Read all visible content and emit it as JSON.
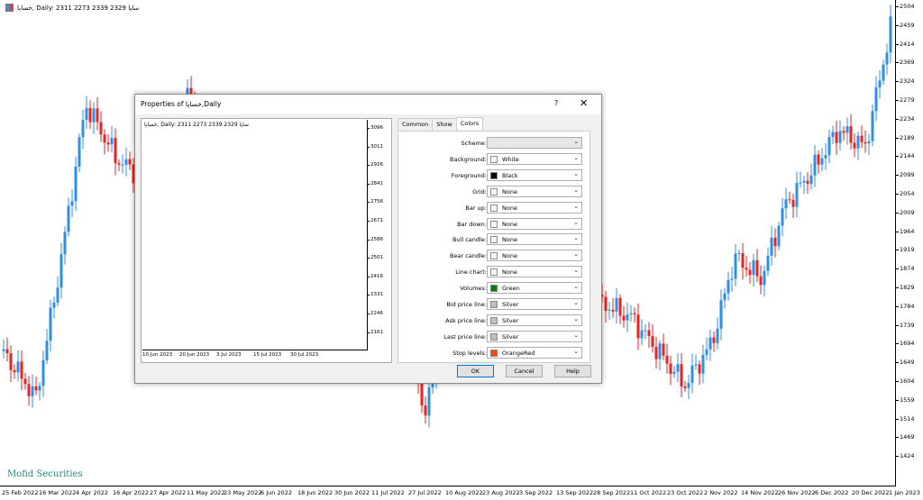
{
  "window": {
    "caption": "خساپا, Daily:  2311 2273 2339 2329  ساپا",
    "watermark": "Mofid Securities"
  },
  "price_scale": [
    "2504",
    "2459",
    "2414",
    "2369",
    "2324",
    "2279",
    "2234",
    "2189",
    "2144",
    "2099",
    "2054",
    "2009",
    "1964",
    "1919",
    "1874",
    "1829",
    "1784",
    "1739",
    "1694",
    "1649",
    "1604",
    "1559",
    "1514",
    "1469",
    "1424"
  ],
  "time_scale": [
    "25 Feb 2022",
    "16 Mar 2022",
    "4 Apr 2022",
    "16 Apr 2022",
    "27 Apr 2022",
    "11 May 2022",
    "23 May 2022",
    "6 Jun 2022",
    "18 Jun 2022",
    "30 Jun 2022",
    "11 Jul 2022",
    "27 Jul 2022",
    "10 Aug 2022",
    "23 Aug 2022",
    "3 Sep 2022",
    "13 Sep 2022",
    "28 Sep 2022",
    "11 Oct 2022",
    "23 Oct 2022",
    "2 Nov 2022",
    "14 Nov 2022",
    "26 Nov 2022",
    "6 Dec 2022",
    "20 Dec 2022",
    "1 Jan 2023"
  ],
  "colors": {
    "bull": "#2f8fe8",
    "bear": "#ee2222",
    "bg": "#ffffff"
  },
  "dialog": {
    "title": "Properties of خساپا,Daily",
    "help_icon": "?",
    "close_icon": "✕",
    "preview": {
      "caption": "خساپا, Daily:  2311 2273 2339 2329  ساپا",
      "prices": [
        "3096",
        "3011",
        "2926",
        "2841",
        "2756",
        "2671",
        "2586",
        "2501",
        "2416",
        "2331",
        "2246",
        "2161"
      ],
      "times": [
        "10 Jun 2023",
        "20 Jun 2023",
        "3 Jul 2023",
        "15 Jul 2023",
        "30 Jul 2023"
      ]
    },
    "tabs": [
      {
        "label": "Common",
        "active": false
      },
      {
        "label": "Show",
        "active": false
      },
      {
        "label": "Colors",
        "active": true
      }
    ],
    "color_rows": [
      {
        "label": "Scheme:",
        "value": "",
        "swatch": "",
        "disabled": true
      },
      {
        "label": "Background:",
        "value": "White",
        "swatch": "#ffffff"
      },
      {
        "label": "Foreground:",
        "value": "Black",
        "swatch": "#000000"
      },
      {
        "label": "Grid:",
        "value": "None",
        "swatch": "#ffffff"
      },
      {
        "label": "Bar up:",
        "value": "None",
        "swatch": "#ffffff"
      },
      {
        "label": "Bar down:",
        "value": "None",
        "swatch": "#ffffff"
      },
      {
        "label": "Bull candle:",
        "value": "None",
        "swatch": "#ffffff"
      },
      {
        "label": "Bear candle:",
        "value": "None",
        "swatch": "#ffffff"
      },
      {
        "label": "Line chart:",
        "value": "None",
        "swatch": "#ffffff"
      },
      {
        "label": "Volumes:",
        "value": "Green",
        "swatch": "#008000"
      },
      {
        "label": "Bid price line:",
        "value": "Silver",
        "swatch": "#c0c0c0"
      },
      {
        "label": "Ask price line:",
        "value": "Silver",
        "swatch": "#c0c0c0"
      },
      {
        "label": "Last price line:",
        "value": "Silver",
        "swatch": "#c0c0c0"
      },
      {
        "label": "Stop levels:",
        "value": "OrangeRed",
        "swatch": "#ff4500"
      }
    ],
    "buttons": {
      "ok": "OK",
      "cancel": "Cancel",
      "help": "Help"
    }
  }
}
